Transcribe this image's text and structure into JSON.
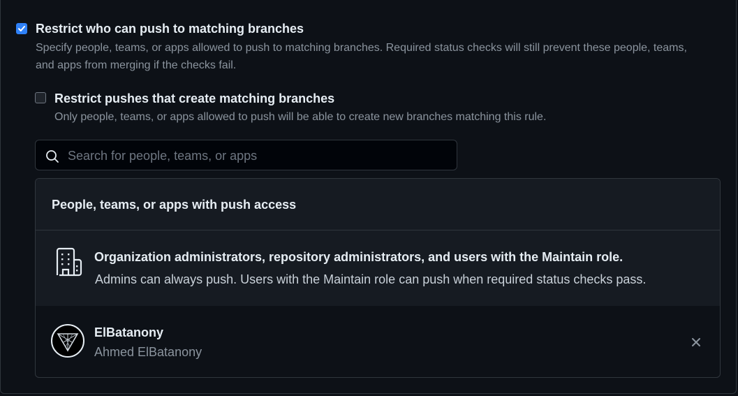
{
  "restrict_push": {
    "checked": true,
    "title": "Restrict who can push to matching branches",
    "description_line1": "Specify people, teams, or apps allowed to push to matching branches. Required status checks will still prevent these people, teams,",
    "description_line2": "and apps from merging if the checks fail."
  },
  "restrict_create": {
    "checked": false,
    "title": "Restrict pushes that create matching branches",
    "description": "Only people, teams, or apps allowed to push will be able to create new branches matching this rule."
  },
  "search": {
    "placeholder": "Search for people, teams, or apps",
    "value": ""
  },
  "push_access": {
    "header": "People, teams, or apps with push access",
    "admin_row": {
      "icon": "organization-icon",
      "title": "Organization administrators, repository administrators, and users with the Maintain role.",
      "description": "Admins can always push. Users with the Maintain role can push when required status checks pass."
    },
    "users": [
      {
        "login": "ElBatanony",
        "name": "Ahmed ElBatanony",
        "remove_icon": "close-icon"
      }
    ]
  },
  "colors": {
    "background": "#0d1117",
    "accent": "#2f81f7",
    "muted_text": "#8b949e",
    "border": "#30363d"
  }
}
